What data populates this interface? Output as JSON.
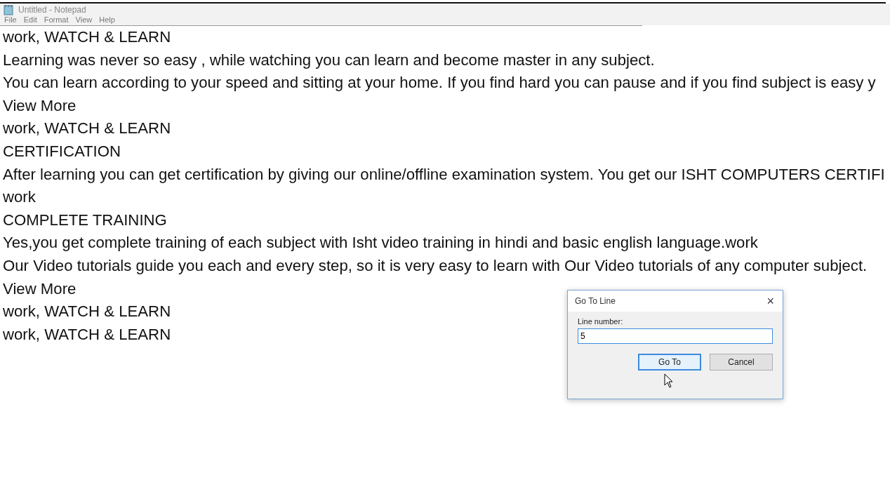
{
  "window": {
    "title": "Untitled - Notepad"
  },
  "menu": [
    "File",
    "Edit",
    "Format",
    "View",
    "Help"
  ],
  "editor": {
    "lines": [
      "work, WATCH & LEARN",
      "Learning was never so easy , while watching you can learn and become master in any subject.",
      "You can learn according to your speed and sitting at your home. If you find hard you can pause and if you find subject is easy y",
      "View More",
      "work, WATCH & LEARN",
      "CERTIFICATION",
      "After learning you can get certification by giving our online/offline examination system. You get our ISHT COMPUTERS CERTIFI",
      "work",
      "COMPLETE TRAINING",
      "Yes,you get complete training of each subject with Isht video training in hindi and basic english language.work",
      "Our Video tutorials guide you each and every step, so it is very easy to learn with Our Video tutorials of any computer subject.",
      "View More",
      "work, WATCH & LEARN",
      "work, WATCH & LEARN"
    ]
  },
  "dialog": {
    "title": "Go To Line",
    "close": "×",
    "field_label": "Line number:",
    "value": "5",
    "buttons": [
      {
        "label": "Go To",
        "selected": true
      },
      {
        "label": "Cancel",
        "selected": false
      }
    ]
  }
}
